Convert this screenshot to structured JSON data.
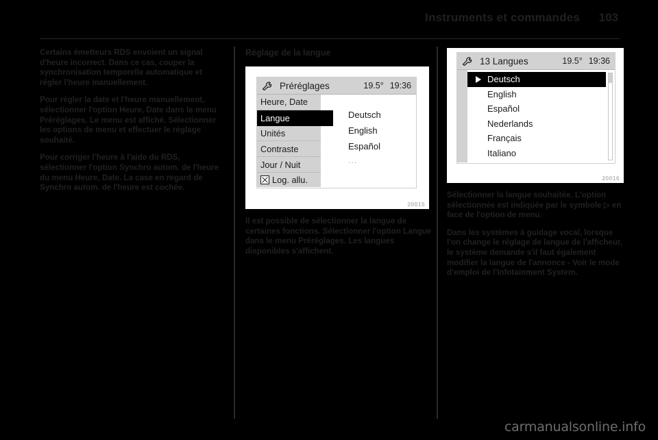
{
  "header": {
    "title": "Instruments et commandes",
    "page_number": "103"
  },
  "columns": {
    "col1": {
      "paragraphs": [
        "Certains émetteurs RDS envoient un signal d'heure incorrect. Dans ce cas, couper la synchronisation temporelle automatique et régler l'heure manuellement.",
        "Pour régler la date et l'heure manuellement, sélectionner l'option Heure, Date dans le menu Préréglages. Le menu est affiché. Sélectionner les options de menu et effectuer le réglage souhaité.",
        "Pour corriger l'heure à l'aide du RDS, sélectionner l'option Synchro autom. de l'heure du menu Heure, Date. La case en regard de Synchro autom. de l'heure est cochée."
      ]
    },
    "col2": {
      "section_title": "Réglage de la langue",
      "figure": {
        "caption": "20015",
        "display": {
          "icon": "wrench-icon",
          "title": "Préréglages",
          "temperature": "19.5°",
          "time": "19:36",
          "menu_items": [
            {
              "label": "Heure, Date",
              "selected": false,
              "checkbox": false
            },
            {
              "label": "Langue",
              "selected": true,
              "checkbox": false
            },
            {
              "label": "Unités",
              "selected": false,
              "checkbox": false
            },
            {
              "label": "Contraste",
              "selected": false,
              "checkbox": false
            },
            {
              "label": "Jour / Nuit",
              "selected": false,
              "checkbox": false
            },
            {
              "label": "Log. allu.",
              "selected": false,
              "checkbox": true
            }
          ],
          "options": [
            {
              "label": "Deutsch",
              "ellipsis": false
            },
            {
              "label": "English",
              "ellipsis": false
            },
            {
              "label": "Español",
              "ellipsis": false
            },
            {
              "label": "...",
              "ellipsis": true
            }
          ]
        }
      },
      "paragraphs": [
        "Il est possible de sélectionner la langue de certaines fonctions. Sélectionner l'option Langue dans le menu Préréglages. Les langues disponibles s'affichent."
      ]
    },
    "col3": {
      "figure": {
        "caption": "20016",
        "display": {
          "icon": "wrench-icon",
          "title": "13 Langues",
          "temperature": "19.5°",
          "time": "19:36",
          "languages": [
            {
              "label": "Deutsch",
              "selected": true
            },
            {
              "label": "English",
              "selected": false
            },
            {
              "label": "Español",
              "selected": false
            },
            {
              "label": "Nederlands",
              "selected": false
            },
            {
              "label": "Français",
              "selected": false
            },
            {
              "label": "Italiano",
              "selected": false
            }
          ]
        }
      },
      "paragraphs": [
        "Sélectionner la langue souhaitée. L'option sélectionnée est indiquée par le symbole ▷ en face de l'option de menu.",
        "Dans les systèmes à guidage vocal, lorsque l'on change le réglage de langue de l'afficheur, le système demande s'il faut également modifier la langue de l'annonce - Voir le mode d'emploi de l'Infotainment System."
      ]
    }
  },
  "watermark": "carmanualsonline.info"
}
